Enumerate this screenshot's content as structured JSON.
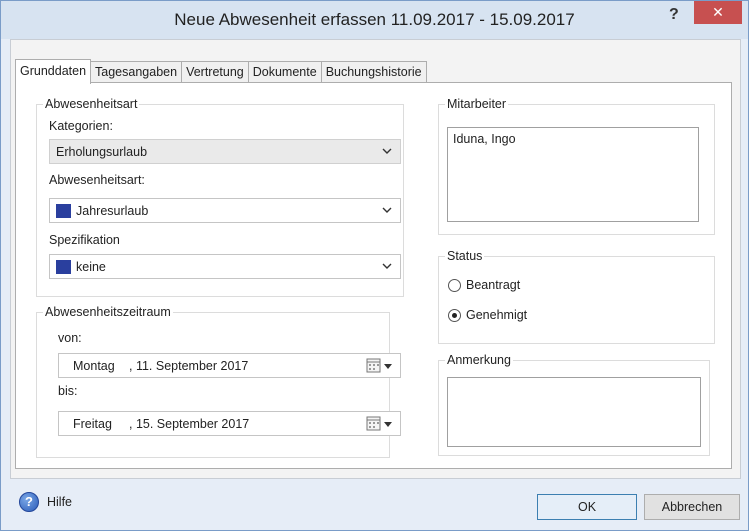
{
  "window": {
    "title": "Neue Abwesenheit erfassen 11.09.2017 - 15.09.2017",
    "help_glyph": "?",
    "close_glyph": "✕"
  },
  "tabs": [
    {
      "label": "Grunddaten",
      "active": true
    },
    {
      "label": "Tagesangaben",
      "active": false
    },
    {
      "label": "Vertretung",
      "active": false
    },
    {
      "label": "Dokumente",
      "active": false
    },
    {
      "label": "Buchungshistorie",
      "active": false
    }
  ],
  "absence_type": {
    "group_label": "Abwesenheitsart",
    "categories_label": "Kategorien:",
    "categories_value": "Erholungsurlaub",
    "type_label": "Abwesenheitsart:",
    "type_value": "Jahresurlaub",
    "specification_label": "Spezifikation",
    "specification_value": "keine",
    "swatch_color": "#2a3f9e"
  },
  "period": {
    "group_label": "Abwesenheitszeitraum",
    "from_label": "von:",
    "from_weekday": "Montag",
    "from_date": ", 11. September 2017",
    "to_label": "bis:",
    "to_weekday": "Freitag",
    "to_date": ", 15. September 2017"
  },
  "employee": {
    "group_label": "Mitarbeiter",
    "value": "Iduna, Ingo"
  },
  "status": {
    "group_label": "Status",
    "options": [
      {
        "label": "Beantragt",
        "checked": false
      },
      {
        "label": "Genehmigt",
        "checked": true
      }
    ]
  },
  "remark": {
    "group_label": "Anmerkung",
    "value": ""
  },
  "footer": {
    "help_label": "Hilfe",
    "ok_label": "OK",
    "cancel_label": "Abbrechen"
  },
  "colors": {
    "close_button": "#c75050",
    "title_bar": "#d7e3f1",
    "swatch": "#2a3f9e"
  }
}
